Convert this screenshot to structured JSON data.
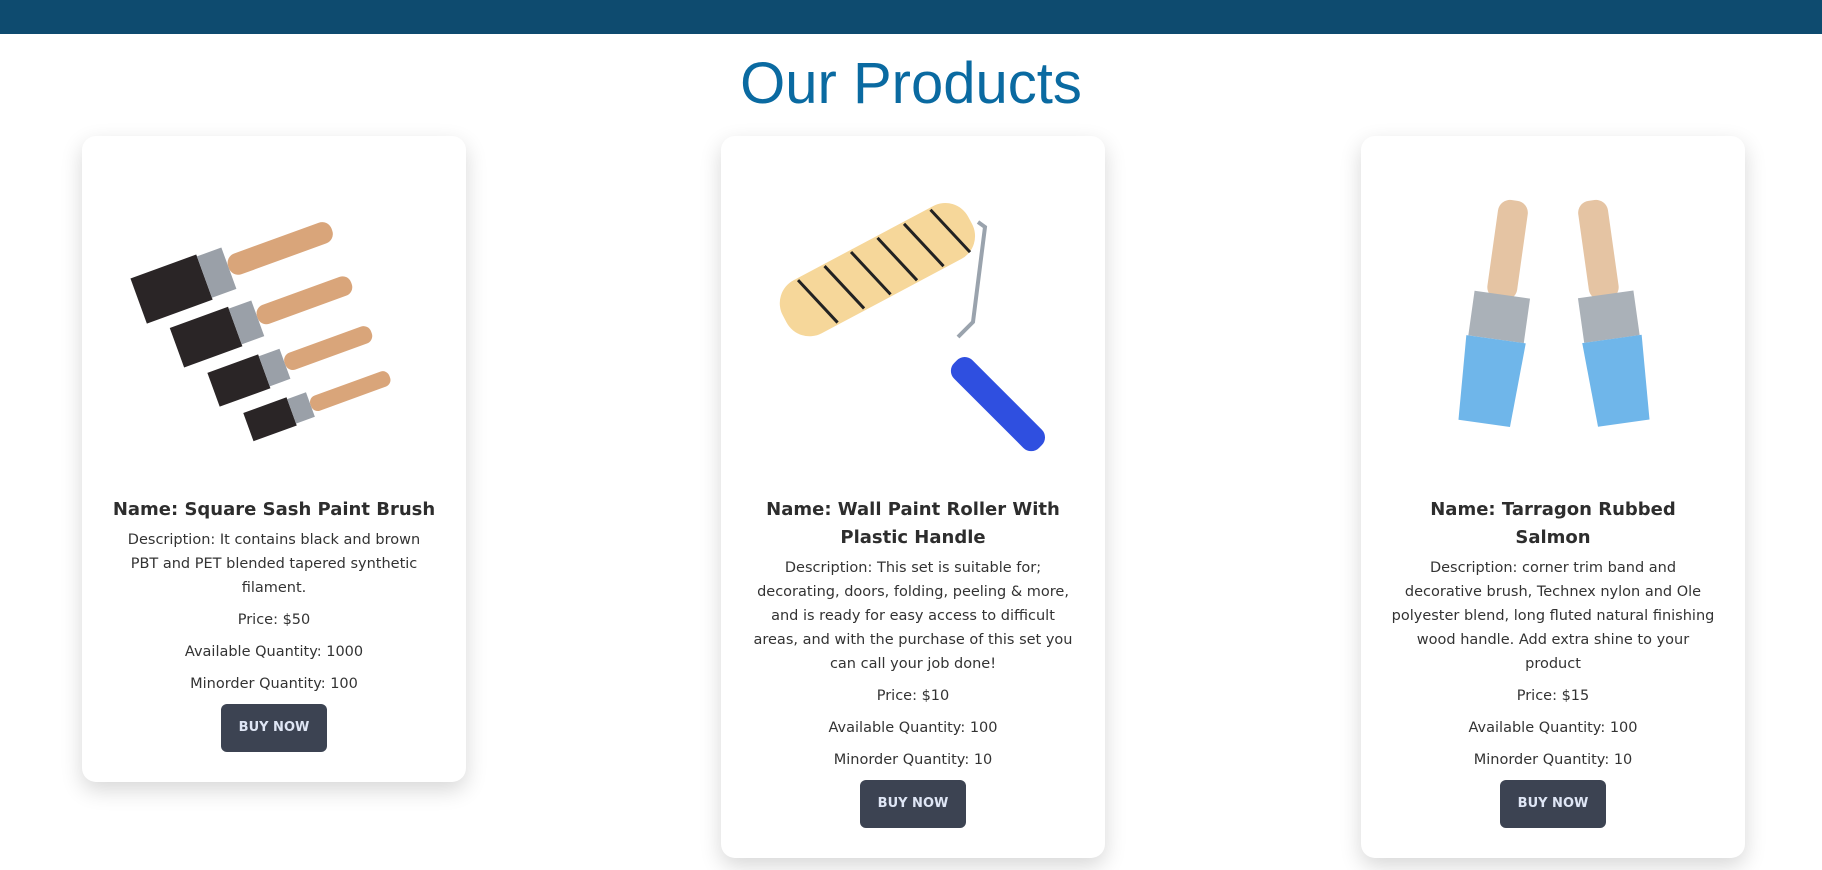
{
  "page_title": "Our Products",
  "buy_label": "BUY NOW",
  "products": [
    {
      "name": "Name: Square Sash Paint Brush",
      "description": "Description: It contains black and brown PBT and PET blended tapered synthetic filament.",
      "price": "Price: $50",
      "available": "Available Quantity: 1000",
      "minorder": "Minorder Quantity: 100",
      "image": "paint-brush-set"
    },
    {
      "name": "Name: Wall Paint Roller With Plastic Handle",
      "description": "Description: This set is suitable for; decorating, doors, folding, peeling & more, and is ready for easy access to difficult areas, and with the purchase of this set you can call your job done!",
      "price": "Price: $10",
      "available": "Available Quantity: 100",
      "minorder": "Minorder Quantity: 10",
      "image": "paint-roller"
    },
    {
      "name": "Name: Tarragon Rubbed Salmon",
      "description": "Description: corner trim band and decorative brush, Technex nylon and Ole polyester blend, long fluted natural finishing wood handle. Add extra shine to your product",
      "price": "Price: $15",
      "available": "Available Quantity: 100",
      "minorder": "Minorder Quantity: 10",
      "image": "blue-brushes"
    }
  ]
}
